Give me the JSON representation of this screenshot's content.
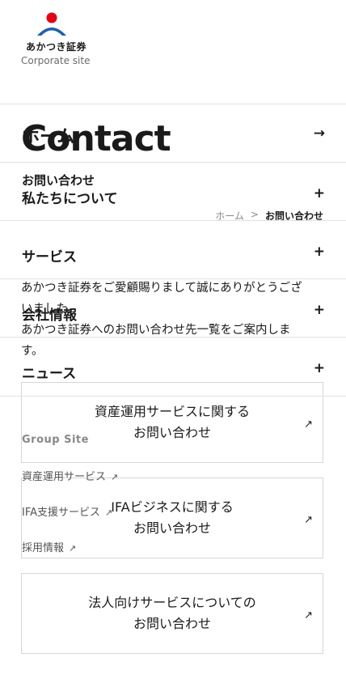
{
  "header": {
    "brand_name": "あかつき証券",
    "brand_sub": "Corporate site",
    "logo_colors": {
      "dot": "#e60012",
      "arc": "#1f5fae"
    }
  },
  "page": {
    "title": "Contact",
    "subtitle": "お問い合わせ",
    "breadcrumb": {
      "home": "ホーム",
      "separator": ">",
      "current": "お問い合わせ"
    },
    "intro": [
      "あかつき証券をご愛顧賜りまして誠にありがとうござ",
      "いました。",
      "あかつき証券へのお問い合わせ先一覧をご案内しま",
      "す。"
    ],
    "cards": [
      {
        "line1": "資産運用サービスに関する",
        "line2": "お問い合わせ",
        "arrow": "↗"
      },
      {
        "line1": "IFAビジネスに関する",
        "line2": "お問い合わせ",
        "arrow": "↗"
      },
      {
        "line1": "法人向けサービスについての",
        "line2": "お問い合わせ",
        "arrow": "↗"
      }
    ]
  },
  "menu": {
    "home": {
      "label": "ホーム",
      "indicator": "→"
    },
    "items": [
      {
        "label": "私たちについて",
        "indicator": "+"
      },
      {
        "label": "サービス",
        "indicator": "+"
      },
      {
        "label": "会社情報",
        "indicator": "+"
      },
      {
        "label": "ニュース",
        "indicator": "+"
      }
    ],
    "group_site": {
      "title": "Group Site",
      "links": [
        {
          "label": "資産運用サービス",
          "icon": "↗"
        },
        {
          "label": "IFA支援サービス",
          "icon": "↗"
        },
        {
          "label": "採用情報",
          "icon": "↗"
        }
      ]
    }
  }
}
